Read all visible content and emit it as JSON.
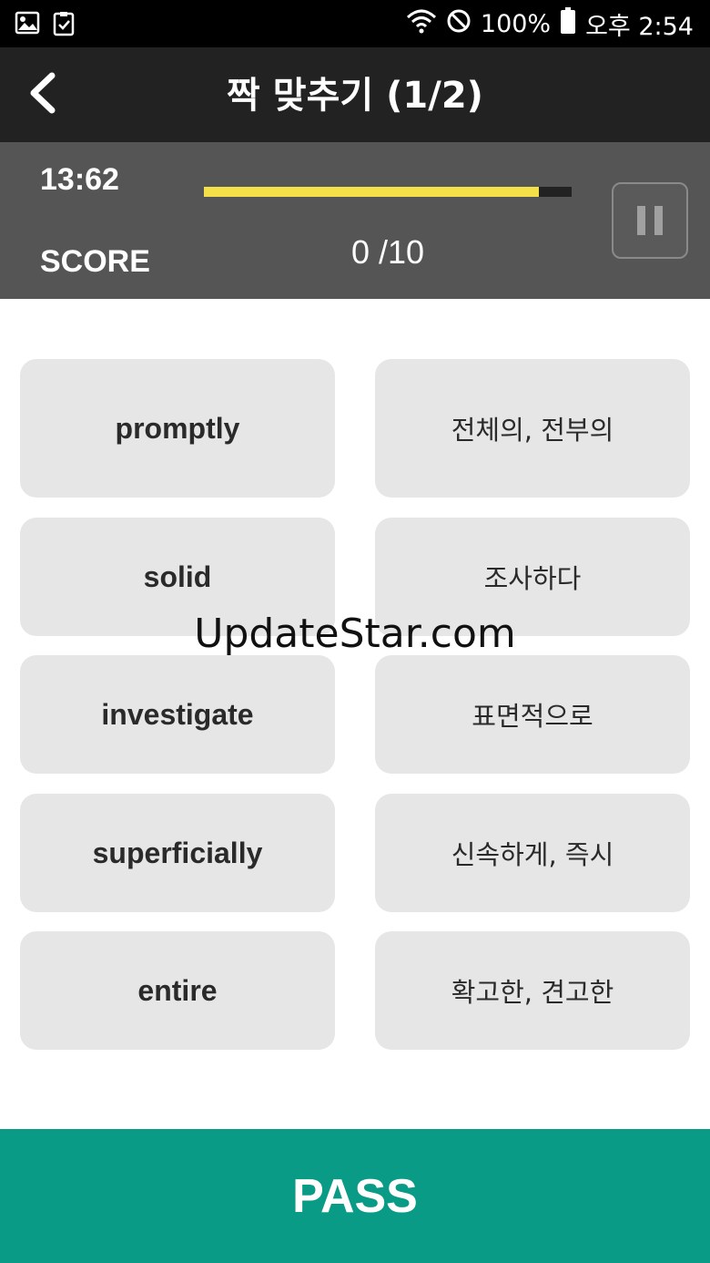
{
  "status_bar": {
    "battery": "100%",
    "time": "오후 2:54",
    "icons": [
      "image-icon",
      "checklist-icon",
      "wifi-icon",
      "do-not-disturb-icon",
      "battery-icon"
    ]
  },
  "header": {
    "back_icon": "chevron-left-icon",
    "title": "짝 맞추기 (1/2)"
  },
  "info": {
    "timer": "13:62",
    "progress": 0.91,
    "score_label": "SCORE",
    "score_value": "0 /10",
    "pause_icon": "pause-icon"
  },
  "cards": {
    "words": [
      "promptly",
      "solid",
      "investigate",
      "superficially",
      "entire"
    ],
    "meanings": [
      "전체의, 전부의",
      "조사하다",
      "표면적으로",
      "신속하게, 즉시",
      "확고한, 견고한"
    ]
  },
  "watermark": "UpdateStar.com",
  "pass_button": "PASS",
  "colors": {
    "header_bg": "#222222",
    "panel_bg": "#555555",
    "progress_fill": "#f4e14a",
    "card_bg": "#e6e6e6",
    "pass_bg": "#0a9b86"
  }
}
